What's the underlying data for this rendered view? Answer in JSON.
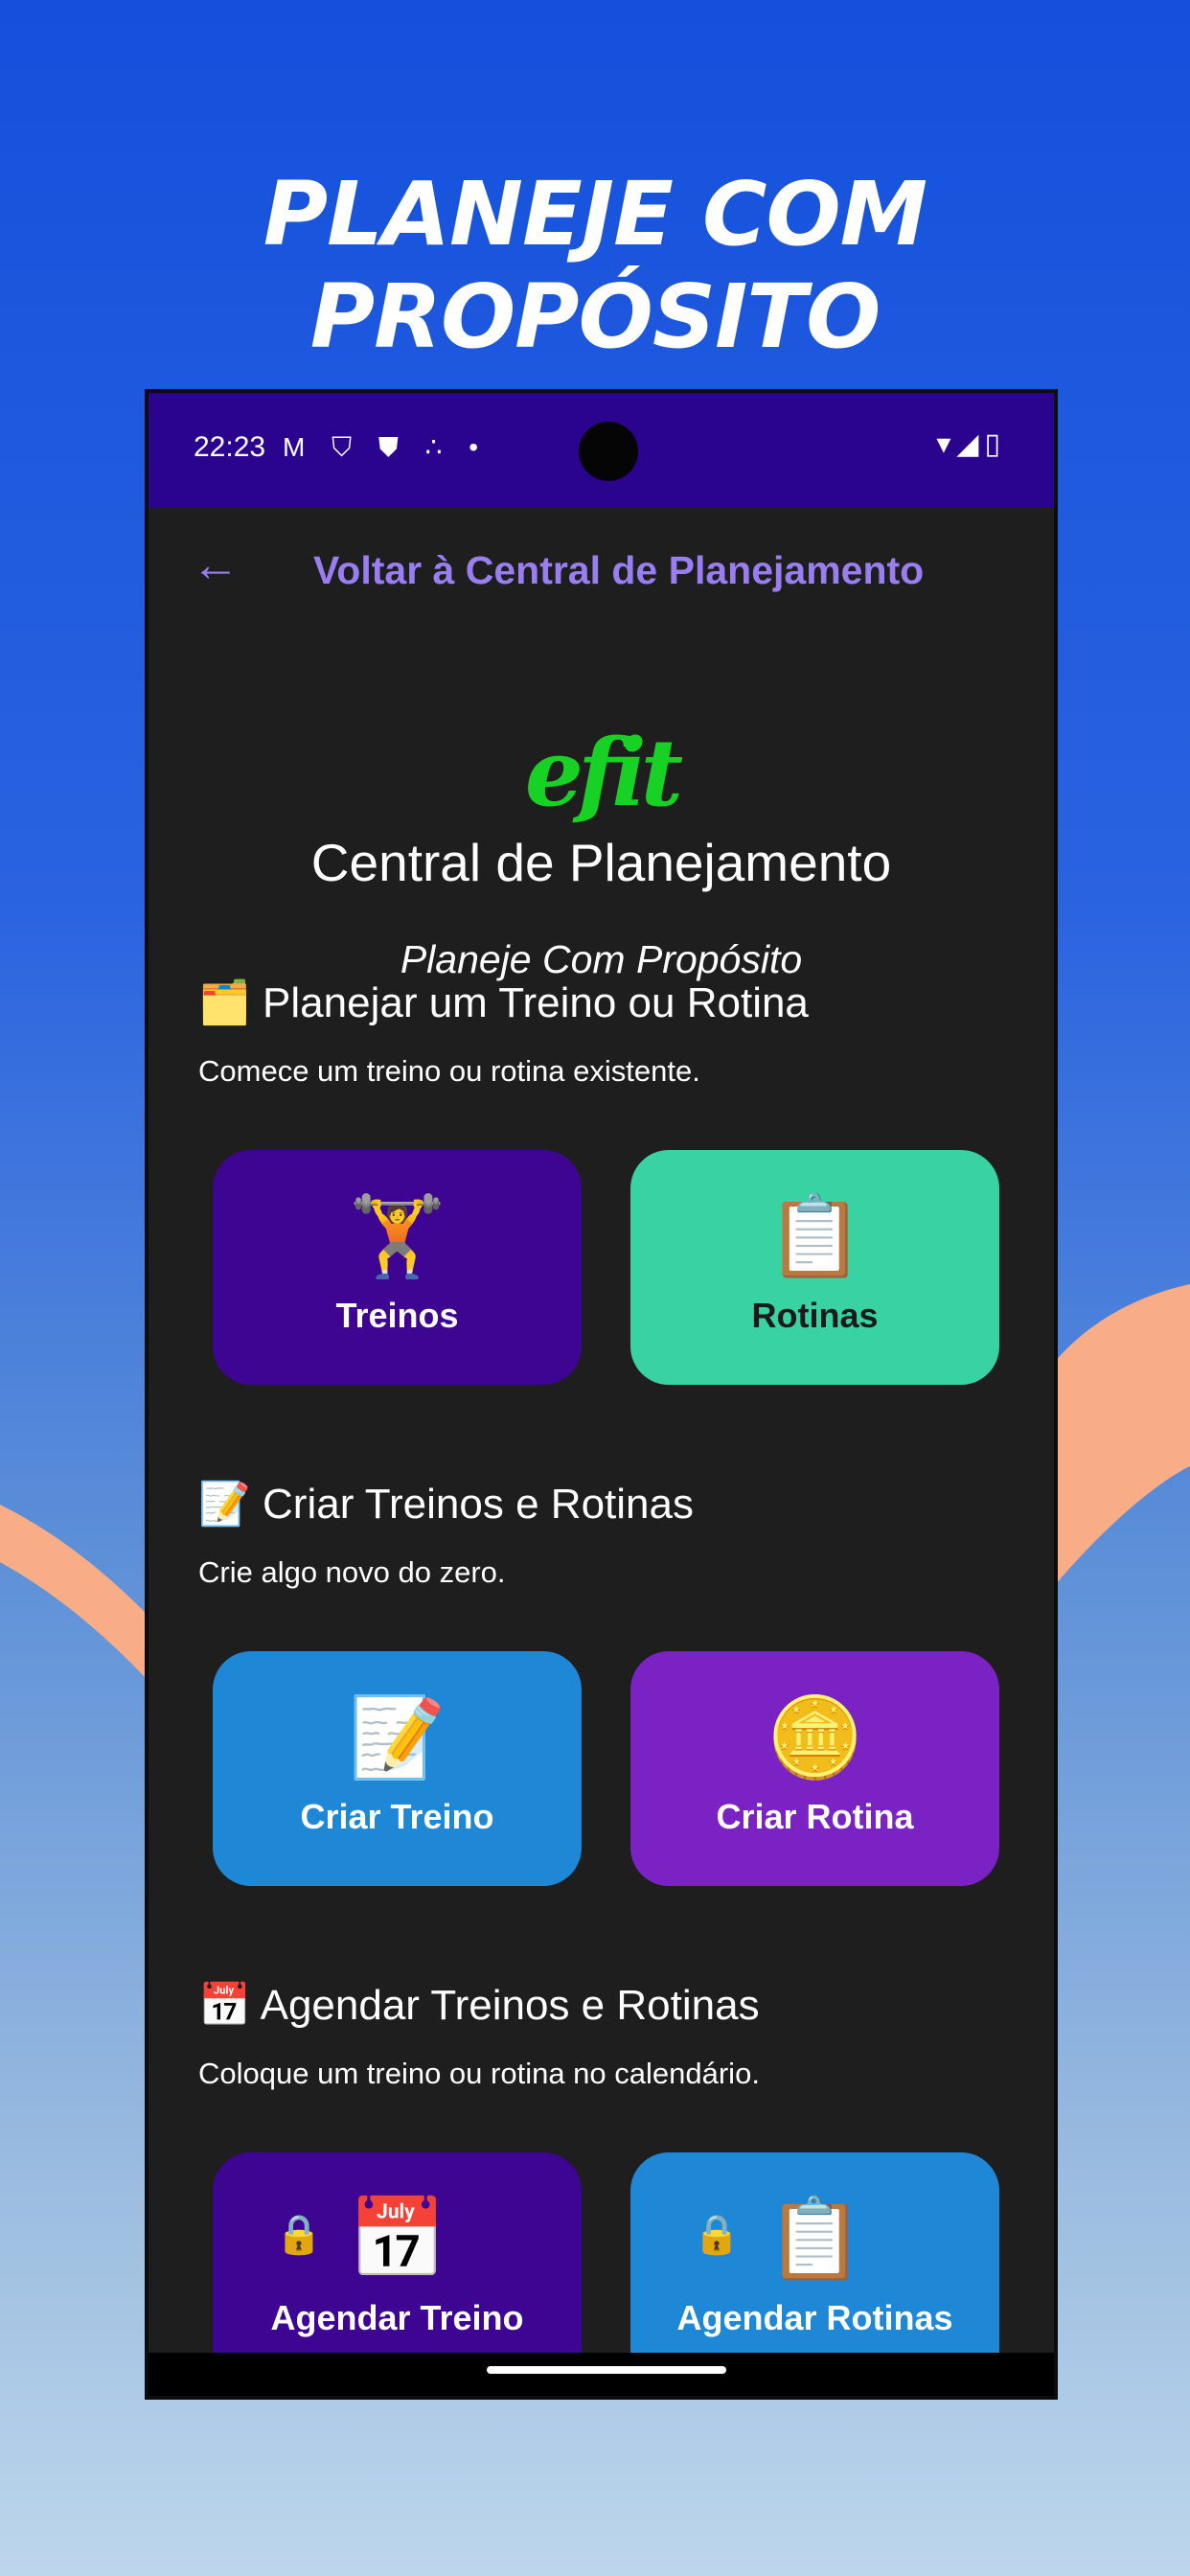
{
  "promo": {
    "headline": "PLANEJE COM PROPÓSITO"
  },
  "status_bar": {
    "time": "22:23",
    "left_icons": "M ⛉ ⛊ ∴ •",
    "right_icons": "▾◢▯"
  },
  "top_bar": {
    "back_icon": "←",
    "title": "Voltar à Central de Planejamento"
  },
  "logo": {
    "text": "efit"
  },
  "header": {
    "title": "Central de Planejamento",
    "subtitle": "Planeje Com Propósito"
  },
  "sections": [
    {
      "icon": "🗂️",
      "title": "Planejar um Treino ou Rotina",
      "description": "Comece um treino ou rotina existente.",
      "cards": [
        {
          "icon": "🏋️",
          "label": "Treinos",
          "bg": "#3d0592",
          "fg": "#ffffff"
        },
        {
          "icon": "📋",
          "label": "Rotinas",
          "bg": "#39d3a3",
          "fg": "#1a1a1a"
        }
      ]
    },
    {
      "icon": "📝",
      "title": "Criar Treinos e Rotinas",
      "description": "Crie algo novo do zero.",
      "cards": [
        {
          "icon": "📝",
          "label": "Criar Treino",
          "bg": "#1f88d6",
          "fg": "#ffffff"
        },
        {
          "icon": "🪙",
          "label": "Criar Rotina",
          "bg": "#7b22c4",
          "fg": "#ffffff"
        }
      ]
    },
    {
      "icon": "📅",
      "title": "Agendar Treinos e Rotinas",
      "description": "Coloque um treino ou rotina no calendário.",
      "cards": [
        {
          "icon": "📅",
          "lock": "🔒",
          "label": "Agendar Treino",
          "bg": "#3d0592",
          "fg": "#ffffff"
        },
        {
          "icon": "📋",
          "lock": "🔒",
          "label": "Agendar Rotinas",
          "bg": "#1f88d6",
          "fg": "#ffffff"
        }
      ]
    }
  ],
  "colors": {
    "status_bar": "#2a048f",
    "background": "#1e1e1e",
    "accent": "#9a7df0",
    "logo_green": "#17d224"
  }
}
